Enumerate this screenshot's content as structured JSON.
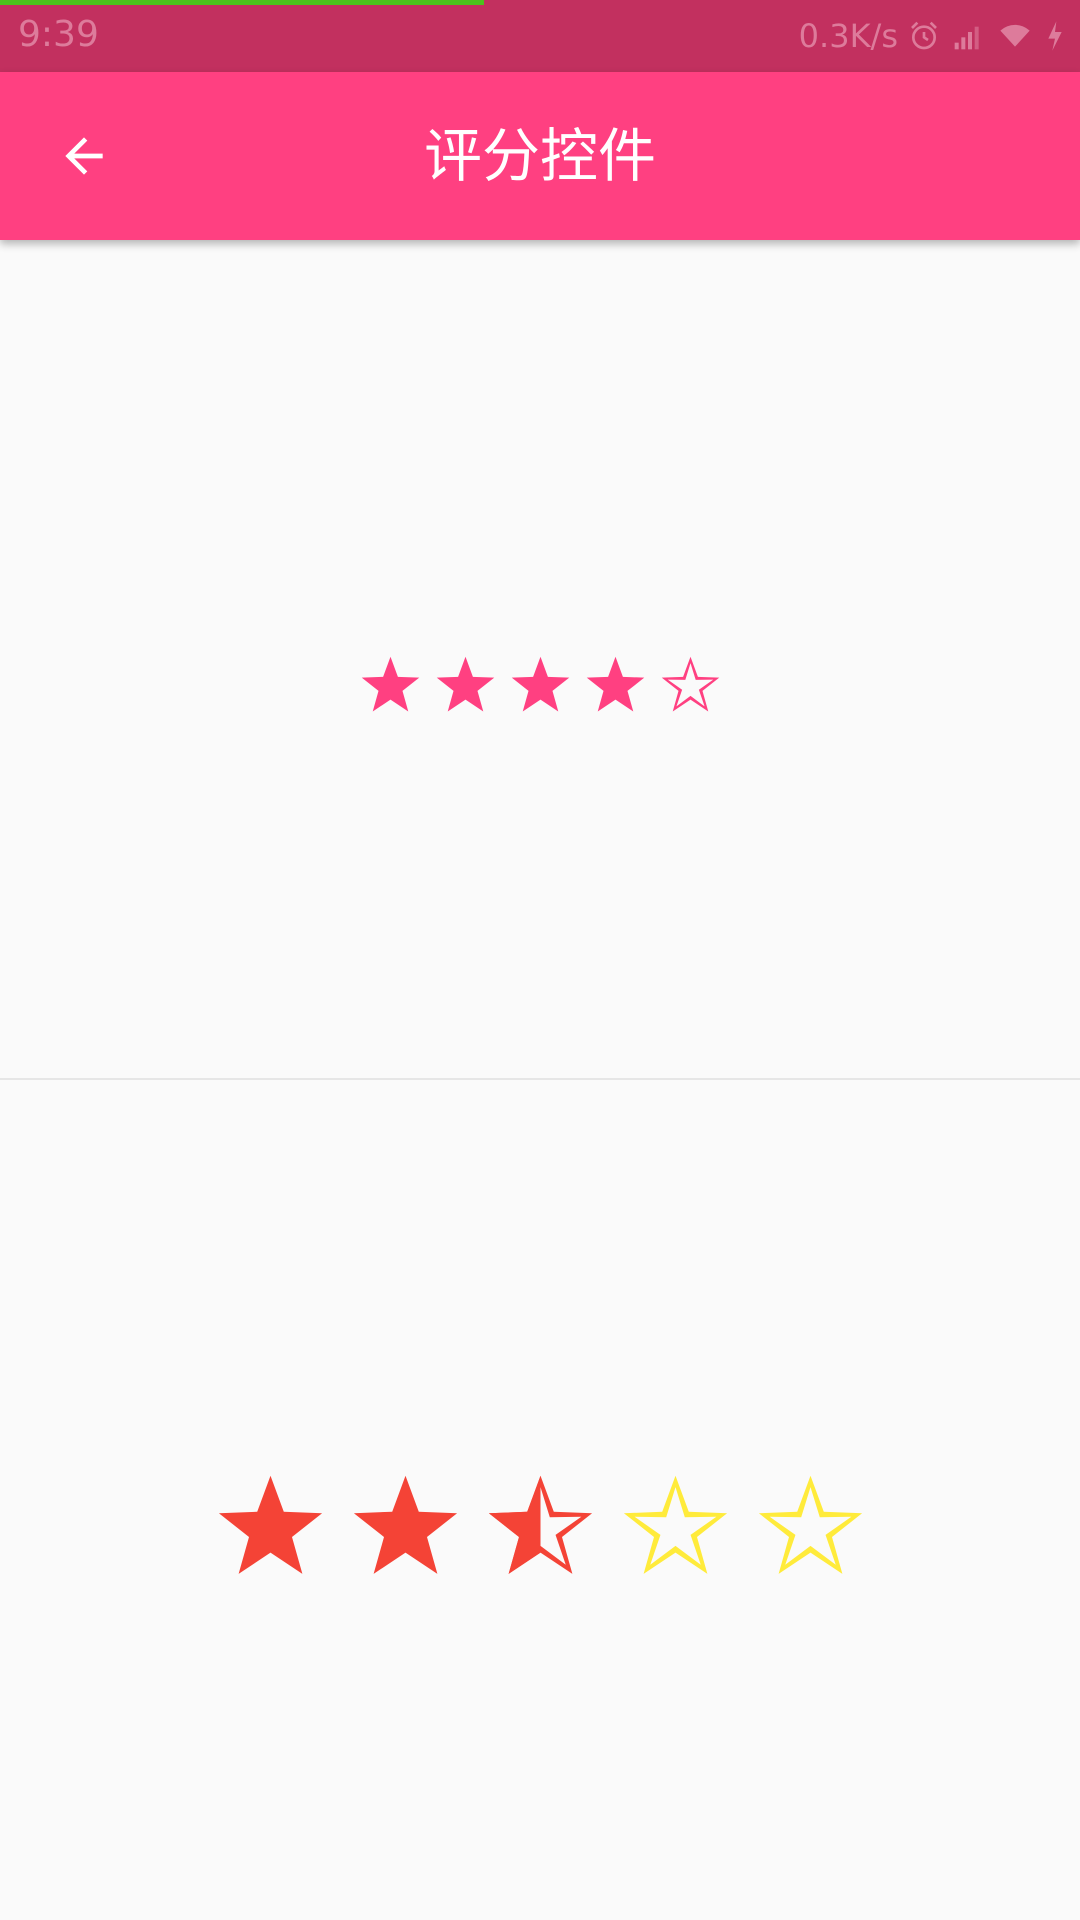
{
  "status_bar": {
    "time": "9:39",
    "net_speed": "0.3K/s",
    "icons": [
      "alarm-icon",
      "signal-icon",
      "wifi-icon",
      "charging-icon"
    ],
    "progress": 0.55
  },
  "app_bar": {
    "title": "评分控件",
    "back_icon": "arrow-back-icon"
  },
  "ratings": [
    {
      "rating": 4,
      "max": 5,
      "filled_color": "#ff4081",
      "empty_color": "#ff4081"
    },
    {
      "rating": 2.5,
      "max": 5,
      "filled_color": "#f44336",
      "empty_color": "#ffeb3b"
    }
  ],
  "colors": {
    "status_bar": "#c2305f",
    "app_bar": "#ff4081",
    "background": "#fafafa",
    "divider": "#e6e6e6",
    "progress": "#4cc21c"
  }
}
